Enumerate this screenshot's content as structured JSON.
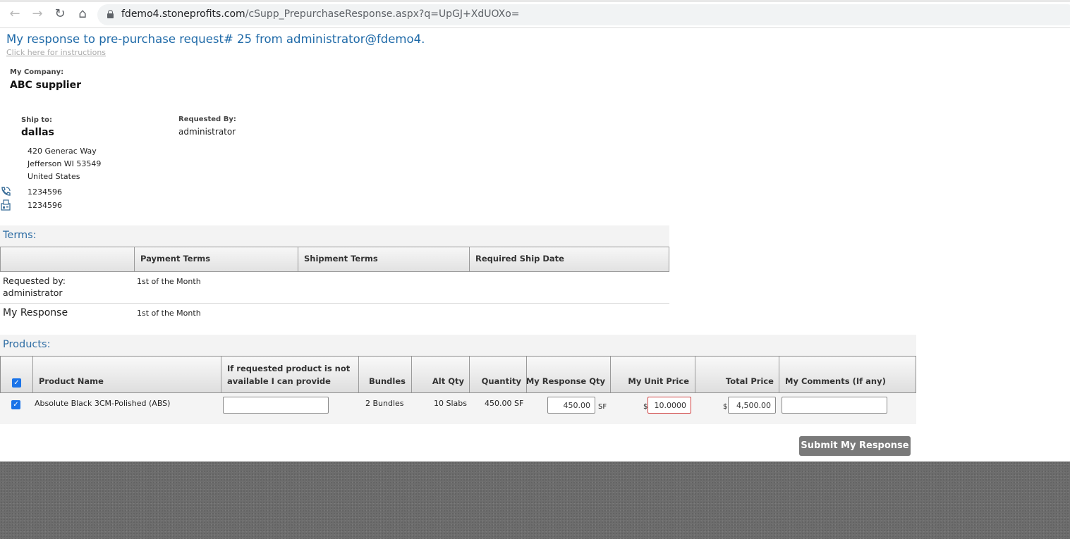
{
  "browser": {
    "url_domain": "fdemo4.stoneprofits.com",
    "url_path": "/cSupp_PrepurchaseResponse.aspx?q=UpGJ+XdUOXo="
  },
  "page": {
    "title": "My response to pre-purchase request# 25 from administrator@fdemo4.",
    "instructions_link": "Click here for instructions"
  },
  "company": {
    "label": "My Company:",
    "name": "ABC supplier"
  },
  "ship_to": {
    "label": "Ship to:",
    "name": "dallas",
    "address_lines": [
      "420 Generac Way",
      "Jefferson WI 53549",
      "United States"
    ],
    "phone": "1234596",
    "fax": "1234596"
  },
  "requested_by": {
    "label": "Requested By:",
    "name": "administrator"
  },
  "terms": {
    "section_title": "Terms:",
    "columns": [
      "",
      "Payment Terms",
      "Shipment Terms",
      "Required Ship Date"
    ],
    "rows": [
      {
        "label_line1": "Requested by:",
        "label_line2": "administrator",
        "payment_terms": "1st of the Month",
        "shipment_terms": "",
        "required_ship_date": ""
      },
      {
        "label_line1": "My Response",
        "label_line2": "",
        "payment_terms": "1st of the Month",
        "shipment_terms": "",
        "required_ship_date": ""
      }
    ]
  },
  "products": {
    "section_title": "Products:",
    "columns": {
      "product_name": "Product Name",
      "alternative_line1": "If requested product is not",
      "alternative_line2": "available I can provide",
      "bundles": "Bundles",
      "alt_qty": "Alt Qty",
      "quantity": "Quantity",
      "my_response_qty": "My Response Qty",
      "my_unit_price": "My Unit Price",
      "total_price": "Total Price",
      "my_comments": "My Comments (If any)"
    },
    "select_all_checked": true,
    "rows": [
      {
        "checked": true,
        "product_name": "Absolute Black 3CM-Polished (ABS)",
        "alternative": "",
        "bundles": "2 Bundles",
        "alt_qty": "10 Slabs",
        "quantity": "450.00 SF",
        "my_response_qty": "450.00",
        "qty_unit": "SF",
        "currency_symbol": "$",
        "my_unit_price": "10.0000",
        "total_price": "4,500.00",
        "my_comments": ""
      }
    ]
  },
  "submit_label": "Submit My Response"
}
